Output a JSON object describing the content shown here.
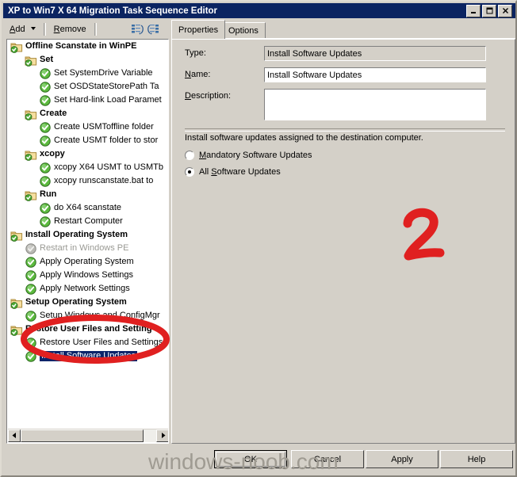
{
  "window": {
    "title": "XP to Win7 X 64 Migration Task Sequence Editor",
    "controls": {
      "minimize": "minimize-button",
      "maximize": "maximize-button",
      "close": "close-button"
    }
  },
  "toolbar": {
    "add_label": "Add",
    "remove_label": "Remove",
    "move_up_icon": "move-up-icon",
    "move_down_icon": "move-down-icon"
  },
  "tabs": [
    {
      "label": "Properties",
      "active": true
    },
    {
      "label": "Options",
      "active": false
    }
  ],
  "tree": {
    "items": [
      {
        "label": "Offline Scanstate in WinPE",
        "indent": 1,
        "icon": "folder-check",
        "bold": true,
        "disabled": false,
        "selected": false
      },
      {
        "label": "Set",
        "indent": 2,
        "icon": "folder-check",
        "bold": true,
        "disabled": false,
        "selected": false
      },
      {
        "label": "Set SystemDrive Variable",
        "indent": 3,
        "icon": "check-circle",
        "bold": false,
        "disabled": false,
        "selected": false
      },
      {
        "label": "Set OSDStateStorePath Ta",
        "indent": 3,
        "icon": "check-circle",
        "bold": false,
        "disabled": false,
        "selected": false
      },
      {
        "label": "Set Hard-link Load Paramet",
        "indent": 3,
        "icon": "check-circle",
        "bold": false,
        "disabled": false,
        "selected": false
      },
      {
        "label": "Create",
        "indent": 2,
        "icon": "folder-check",
        "bold": true,
        "disabled": false,
        "selected": false
      },
      {
        "label": "Create USMToffline folder",
        "indent": 3,
        "icon": "check-circle",
        "bold": false,
        "disabled": false,
        "selected": false
      },
      {
        "label": "Create USMT folder to stor",
        "indent": 3,
        "icon": "check-circle",
        "bold": false,
        "disabled": false,
        "selected": false
      },
      {
        "label": "xcopy",
        "indent": 2,
        "icon": "folder-check",
        "bold": true,
        "disabled": false,
        "selected": false
      },
      {
        "label": "xcopy X64 USMT to USMTb",
        "indent": 3,
        "icon": "check-circle",
        "bold": false,
        "disabled": false,
        "selected": false
      },
      {
        "label": "xcopy runscanstate.bat to",
        "indent": 3,
        "icon": "check-circle",
        "bold": false,
        "disabled": false,
        "selected": false
      },
      {
        "label": "Run",
        "indent": 2,
        "icon": "folder-check",
        "bold": true,
        "disabled": false,
        "selected": false
      },
      {
        "label": "do X64 scanstate",
        "indent": 3,
        "icon": "check-circle",
        "bold": false,
        "disabled": false,
        "selected": false
      },
      {
        "label": "Restart Computer",
        "indent": 3,
        "icon": "check-circle",
        "bold": false,
        "disabled": false,
        "selected": false
      },
      {
        "label": "Install Operating System",
        "indent": 1,
        "icon": "folder-check",
        "bold": true,
        "disabled": false,
        "selected": false
      },
      {
        "label": "Restart in Windows PE",
        "indent": 2,
        "icon": "check-circle-disabled",
        "bold": false,
        "disabled": true,
        "selected": false
      },
      {
        "label": "Apply Operating System",
        "indent": 2,
        "icon": "check-circle",
        "bold": false,
        "disabled": false,
        "selected": false
      },
      {
        "label": "Apply Windows Settings",
        "indent": 2,
        "icon": "check-circle",
        "bold": false,
        "disabled": false,
        "selected": false
      },
      {
        "label": "Apply Network Settings",
        "indent": 2,
        "icon": "check-circle",
        "bold": false,
        "disabled": false,
        "selected": false
      },
      {
        "label": "Setup Operating System",
        "indent": 1,
        "icon": "folder-check",
        "bold": true,
        "disabled": false,
        "selected": false
      },
      {
        "label": "Setup Windows and ConfigMgr",
        "indent": 2,
        "icon": "check-circle",
        "bold": false,
        "disabled": false,
        "selected": false
      },
      {
        "label": "Restore User Files and Setting",
        "indent": 1,
        "icon": "folder-check",
        "bold": true,
        "disabled": false,
        "selected": false
      },
      {
        "label": "Restore User Files and Settings",
        "indent": 2,
        "icon": "check-circle",
        "bold": false,
        "disabled": false,
        "selected": false
      },
      {
        "label": "Install Software Updates",
        "indent": 2,
        "icon": "check-circle",
        "bold": false,
        "disabled": false,
        "selected": true
      }
    ],
    "hscrollbar": {
      "left_arrow": "scroll-left-arrow",
      "right_arrow": "scroll-right-arrow"
    }
  },
  "properties": {
    "type_label": "Type:",
    "type_value": "Install Software Updates",
    "name_label": "Name:",
    "name_accel": "N",
    "name_value": "Install Software Updates",
    "description_label": "Description:",
    "description_accel": "D",
    "description_value": "",
    "description_placeholder": "",
    "instruction": "Install software updates assigned to the destination computer.",
    "options": [
      {
        "label_pre": "",
        "accel": "M",
        "label_post": "andatory Software Updates",
        "full": "Mandatory Software Updates",
        "checked": false
      },
      {
        "label_pre": "All ",
        "accel": "S",
        "label_post": "oftware Updates",
        "full": "All Software Updates",
        "checked": true
      }
    ]
  },
  "buttons": [
    {
      "label": "OK",
      "default": true
    },
    {
      "label": "Cancel",
      "default": false
    },
    {
      "label": "Apply",
      "default": false
    },
    {
      "label": "Help",
      "default": false
    }
  ],
  "annotations": {
    "step_number": "2",
    "step_number_color": "#e02020",
    "highlight_ellipse_color": "#e02020",
    "highlight_target": "Install Software Updates",
    "watermark": "windows-noob.com"
  },
  "colors": {
    "titlebar": "#0b2461",
    "face": "#d4d0c8",
    "selection": "#0a246a",
    "accent_red": "#e02020"
  }
}
